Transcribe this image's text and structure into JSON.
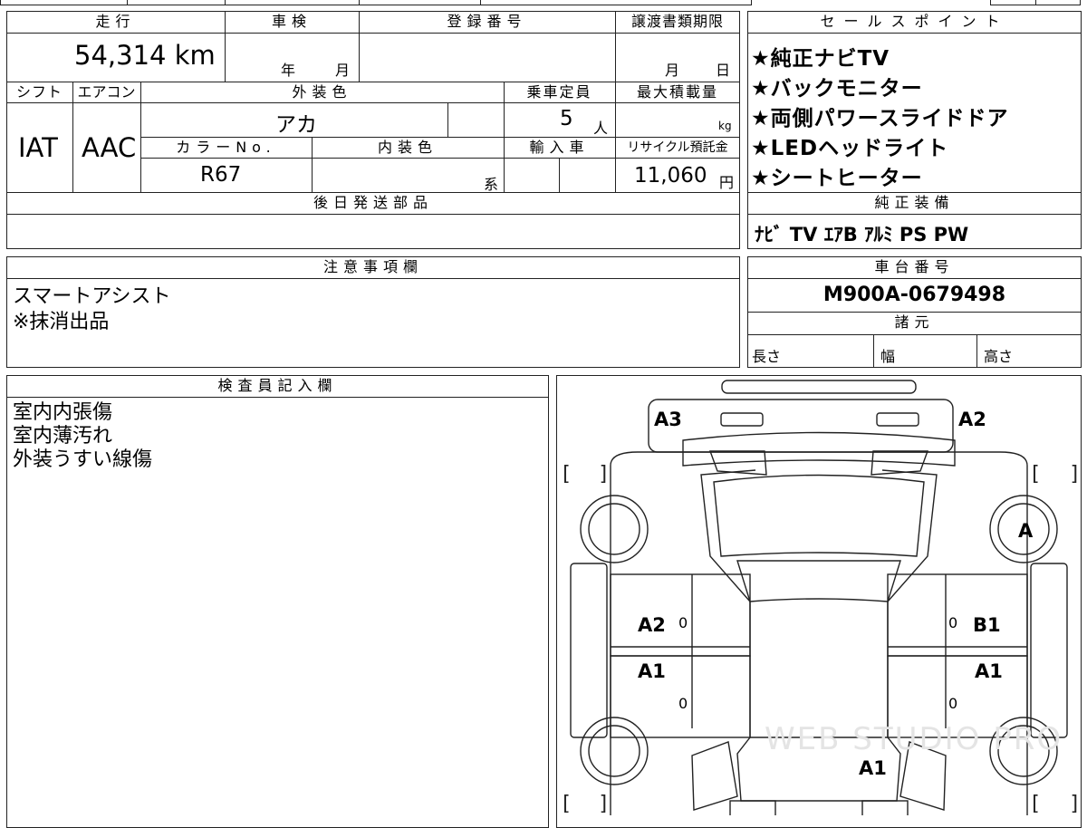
{
  "main": {
    "headers": {
      "mileage": "走行",
      "shaken": "車検",
      "registration": "登録番号",
      "transfer_deadline": "譲渡書類期限",
      "shift": "シフト",
      "aircon": "エアコン",
      "exterior_color": "外装色",
      "capacity": "乗車定員",
      "max_load": "最大積載量",
      "color_no": "カラーNo.",
      "interior_color": "内装色",
      "import": "輸入車",
      "recycle": "リサイクル預託金",
      "later_parts": "後日発送部品"
    },
    "values": {
      "mileage": "54,314 km",
      "shaken_year_unit": "年",
      "shaken_month_unit": "月",
      "transfer_month_unit": "月",
      "transfer_day_unit": "日",
      "shift": "IAT",
      "aircon": "AAC",
      "exterior_color": "アカ",
      "capacity": "5",
      "capacity_unit": "人",
      "max_load_unit": "kg",
      "color_no": "R67",
      "interior_suffix": "系",
      "recycle": "11,060",
      "recycle_unit": "円"
    }
  },
  "sales": {
    "header": "セールスポイント",
    "items": [
      "★純正ナビTV",
      "★バックモニター",
      "★両側パワースライドドア",
      "★LEDヘッドライト",
      "★シートヒーター"
    ]
  },
  "equipment": {
    "header": "純正装備",
    "value": "ﾅﾋﾞ TV ｴｱB ｱﾙﾐ PS PW"
  },
  "notes": {
    "header": "注意事項欄",
    "lines": [
      "スマートアシスト",
      "※抹消出品"
    ]
  },
  "chassis": {
    "header": "車台番号",
    "value": "M900A-0679498"
  },
  "specs": {
    "header": "諸元",
    "length": "長さ",
    "width": "幅",
    "height": "高さ"
  },
  "inspector": {
    "header": "検査員記入欄",
    "lines": [
      "室内内張傷",
      "室内薄汚れ",
      "外装うすい線傷"
    ]
  },
  "diagram": {
    "marks": {
      "front_left_corner": "A3",
      "front_right_corner": "A2",
      "right_front_wheel": "A",
      "left_front_door": "A2",
      "right_front_door": "B1",
      "left_rear_door": "A1",
      "right_rear_door": "A1",
      "rear": "A1"
    },
    "door_zero": "0",
    "watermark": "WEB STUDIO PRO"
  }
}
